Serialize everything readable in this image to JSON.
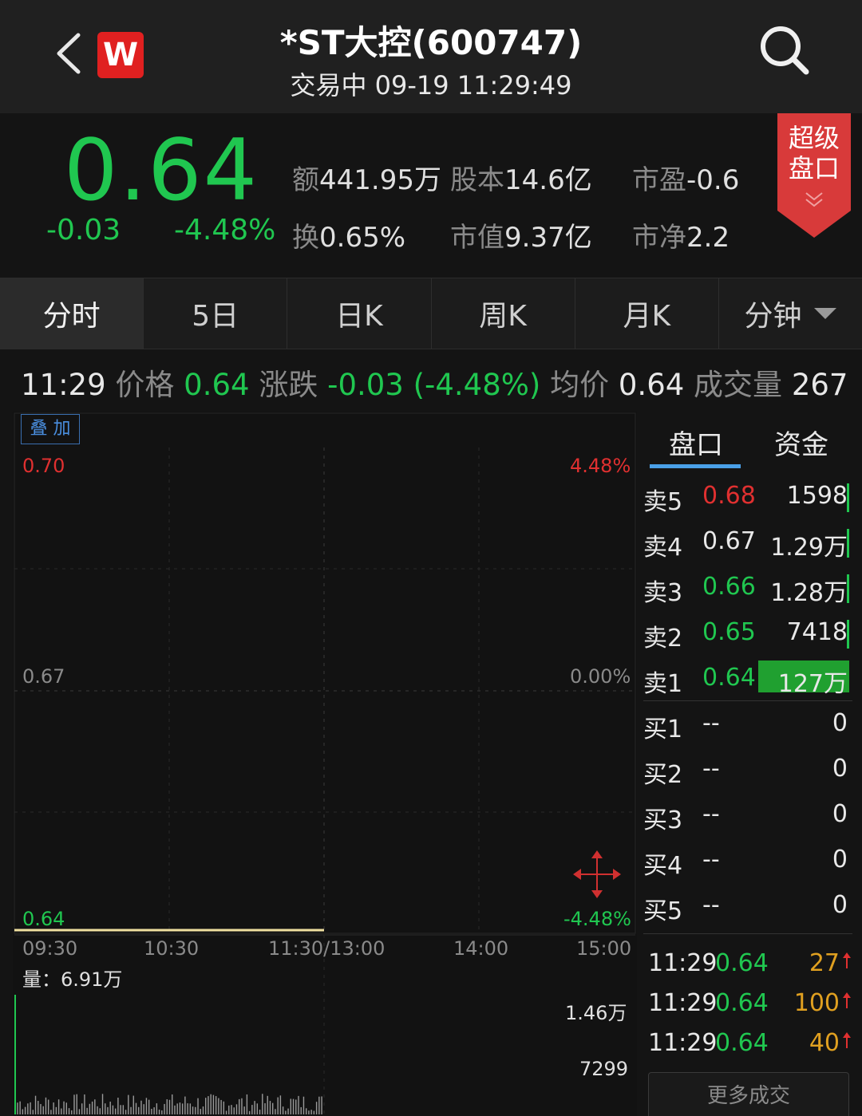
{
  "header": {
    "title": "*ST大控(600747)",
    "subtitle": "交易中 09-19 11:29:49",
    "logo": "W"
  },
  "quote": {
    "price": "0.64",
    "change": "-0.03",
    "change_pct": "-4.48%",
    "stats": [
      {
        "label": "额",
        "value": "441.95万"
      },
      {
        "label": "股本",
        "value": "14.6亿"
      },
      {
        "label": "市盈",
        "value": "-0.6"
      },
      {
        "label": "换",
        "value": "0.65%"
      },
      {
        "label": "市值",
        "value": "9.37亿"
      },
      {
        "label": "市净",
        "value": "2.2"
      }
    ],
    "super_btn": {
      "line1": "超级",
      "line2": "盘口"
    }
  },
  "tabs": [
    {
      "label": "分时"
    },
    {
      "label": "5日"
    },
    {
      "label": "日K"
    },
    {
      "label": "周K"
    },
    {
      "label": "月K"
    },
    {
      "label": "分钟"
    }
  ],
  "info": {
    "time": "11:29",
    "price_label": "价格",
    "price": "0.64",
    "change_label": "涨跌",
    "change": "-0.03 (-4.48%)",
    "avg_label": "均价",
    "avg": "0.64",
    "vol_label": "成交量",
    "vol": "267"
  },
  "chart": {
    "overlay_btn": "叠 加",
    "y_left": [
      "0.70",
      "0.67",
      "0.64"
    ],
    "y_right": [
      "4.48%",
      "0.00%",
      "-4.48%"
    ],
    "x_ticks": [
      "09:30",
      "10:30",
      "11:30/13:00",
      "14:00",
      "15:00"
    ],
    "volume_label": "量：6.91万",
    "vol_ticks": [
      "1.46万",
      "7299"
    ],
    "colors": {
      "up": "#e03030",
      "down": "#20c750",
      "price_line": "#f0e0a0"
    }
  },
  "chart_data": {
    "type": "line",
    "x": [
      "09:30",
      "10:30",
      "11:30"
    ],
    "series": [
      {
        "values": [
          0.64,
          0.64,
          0.64
        ]
      }
    ],
    "ylim": [
      0.64,
      0.7
    ],
    "volume_ylim": [
      0,
      14600
    ]
  },
  "side": {
    "tabs": [
      "盘口",
      "资金"
    ],
    "orderbook": [
      {
        "label": "卖5",
        "price": "0.68",
        "vol": "1598",
        "color": "red"
      },
      {
        "label": "卖4",
        "price": "0.67",
        "vol": "1.29万",
        "color": "white"
      },
      {
        "label": "卖3",
        "price": "0.66",
        "vol": "1.28万",
        "color": "green"
      },
      {
        "label": "卖2",
        "price": "0.65",
        "vol": "7418",
        "color": "green"
      },
      {
        "label": "卖1",
        "price": "0.64",
        "vol": "127万",
        "color": "green"
      },
      {
        "label": "买1",
        "price": "--",
        "vol": "0",
        "color": "white"
      },
      {
        "label": "买2",
        "price": "--",
        "vol": "0",
        "color": "white"
      },
      {
        "label": "买3",
        "price": "--",
        "vol": "0",
        "color": "white"
      },
      {
        "label": "买4",
        "price": "--",
        "vol": "0",
        "color": "white"
      },
      {
        "label": "买5",
        "price": "--",
        "vol": "0",
        "color": "white"
      }
    ],
    "trades": [
      {
        "time": "11:29",
        "price": "0.64",
        "vol": "27"
      },
      {
        "time": "11:29",
        "price": "0.64",
        "vol": "100"
      },
      {
        "time": "11:29",
        "price": "0.64",
        "vol": "40"
      }
    ],
    "more_btn": "更多成交"
  }
}
